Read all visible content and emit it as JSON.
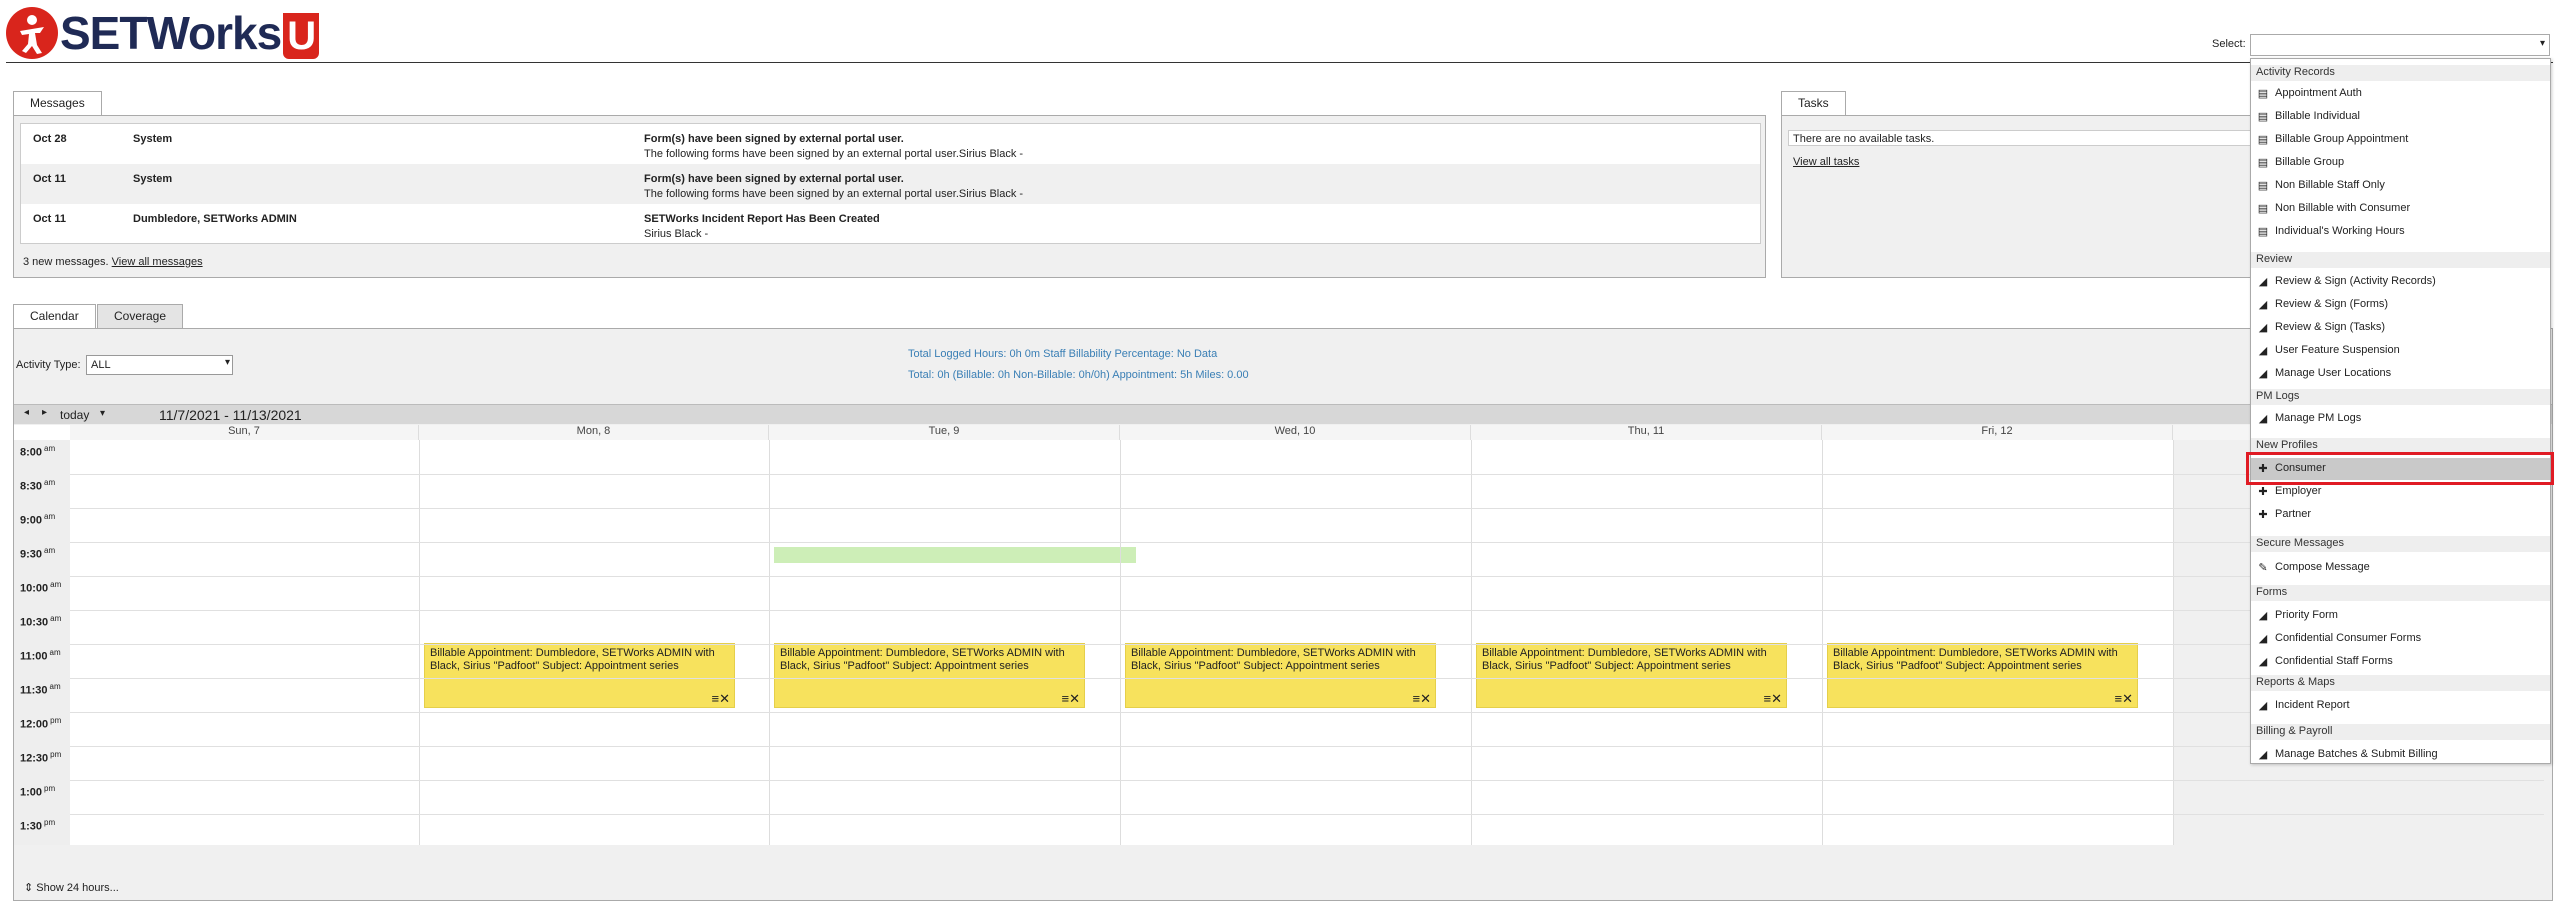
{
  "header": {
    "brand": "SETWorks",
    "brand_suffix": "U",
    "select_label": "Select:"
  },
  "messages": {
    "tab": "Messages",
    "rows": [
      {
        "date": "Oct 28",
        "from": "System",
        "subject": "Form(s) have been signed by external portal user.",
        "body": "The following forms have been signed by an external portal user.Sirius Black -"
      },
      {
        "date": "Oct 11",
        "from": "System",
        "subject": "Form(s) have been signed by external portal user.",
        "body": "The following forms have been signed by an external portal user.Sirius Black -"
      },
      {
        "date": "Oct 11",
        "from": "Dumbledore, SETWorks ADMIN",
        "subject": "SETWorks Incident Report Has Been Created",
        "body": "Sirius Black -"
      }
    ],
    "footer_count": "3 new messages.",
    "footer_link": "View all messages"
  },
  "tasks": {
    "tab": "Tasks",
    "empty": "There are no available tasks.",
    "link": "View all tasks"
  },
  "calendar": {
    "tabs": [
      "Calendar",
      "Coverage"
    ],
    "activity_label": "Activity Type:",
    "activity_value": "ALL",
    "stats_line1": "Total Logged Hours: 0h 0m   Staff Billability Percentage: No Data",
    "stats_line2": "Total: 0h   (Billable: 0h   Non-Billable: 0h/0h)   Appointment: 5h   Miles: 0.00",
    "today": "today",
    "range": "11/7/2021 - 11/13/2021",
    "days": [
      "Sun, 7",
      "Mon, 8",
      "Tue, 9",
      "Wed, 10",
      "Thu, 11",
      "Fri, 12"
    ],
    "times": [
      {
        "t": "8:00",
        "ap": "am"
      },
      {
        "t": "8:30",
        "ap": "am"
      },
      {
        "t": "9:00",
        "ap": "am"
      },
      {
        "t": "9:30",
        "ap": "am"
      },
      {
        "t": "10:00",
        "ap": "am"
      },
      {
        "t": "10:30",
        "ap": "am"
      },
      {
        "t": "11:00",
        "ap": "am"
      },
      {
        "t": "11:30",
        "ap": "am"
      },
      {
        "t": "12:00",
        "ap": "pm"
      },
      {
        "t": "12:30",
        "ap": "pm"
      },
      {
        "t": "1:00",
        "ap": "pm"
      },
      {
        "t": "1:30",
        "ap": "pm"
      }
    ],
    "appointment_text": "Billable Appointment: Dumbledore, SETWorks ADMIN with Black, Sirius \"Padfoot\" Subject: Appointment series",
    "show24": "Show 24 hours..."
  },
  "dropdown": {
    "groups": [
      {
        "title": "Activity Records",
        "items": [
          "Appointment Auth",
          "Billable Individual",
          "Billable Group Appointment",
          "Billable Group",
          "Non Billable Staff Only",
          "Non Billable with Consumer",
          "Individual's Working Hours"
        ]
      },
      {
        "title": "Review",
        "items": [
          "Review & Sign (Activity Records)",
          "Review & Sign (Forms)",
          "Review & Sign (Tasks)",
          "User Feature Suspension",
          "Manage User Locations"
        ]
      },
      {
        "title": "PM Logs",
        "items": [
          "Manage PM Logs"
        ]
      },
      {
        "title": "New Profiles",
        "items": [
          "Consumer",
          "Employer",
          "Partner"
        ]
      },
      {
        "title": "Secure Messages",
        "items": [
          "Compose Message"
        ]
      },
      {
        "title": "Forms",
        "items": [
          "Priority Form",
          "Confidential Consumer Forms",
          "Confidential Staff Forms"
        ]
      },
      {
        "title": "Reports & Maps",
        "items": [
          "Incident Report"
        ]
      },
      {
        "title": "Billing & Payroll",
        "items": [
          "Manage Batches & Submit Billing"
        ]
      }
    ]
  },
  "colors": {
    "brand_red": "#d9251c",
    "brand_navy": "#1f2a55",
    "appointment": "#f7e25d",
    "highlight": "#e01b24"
  }
}
